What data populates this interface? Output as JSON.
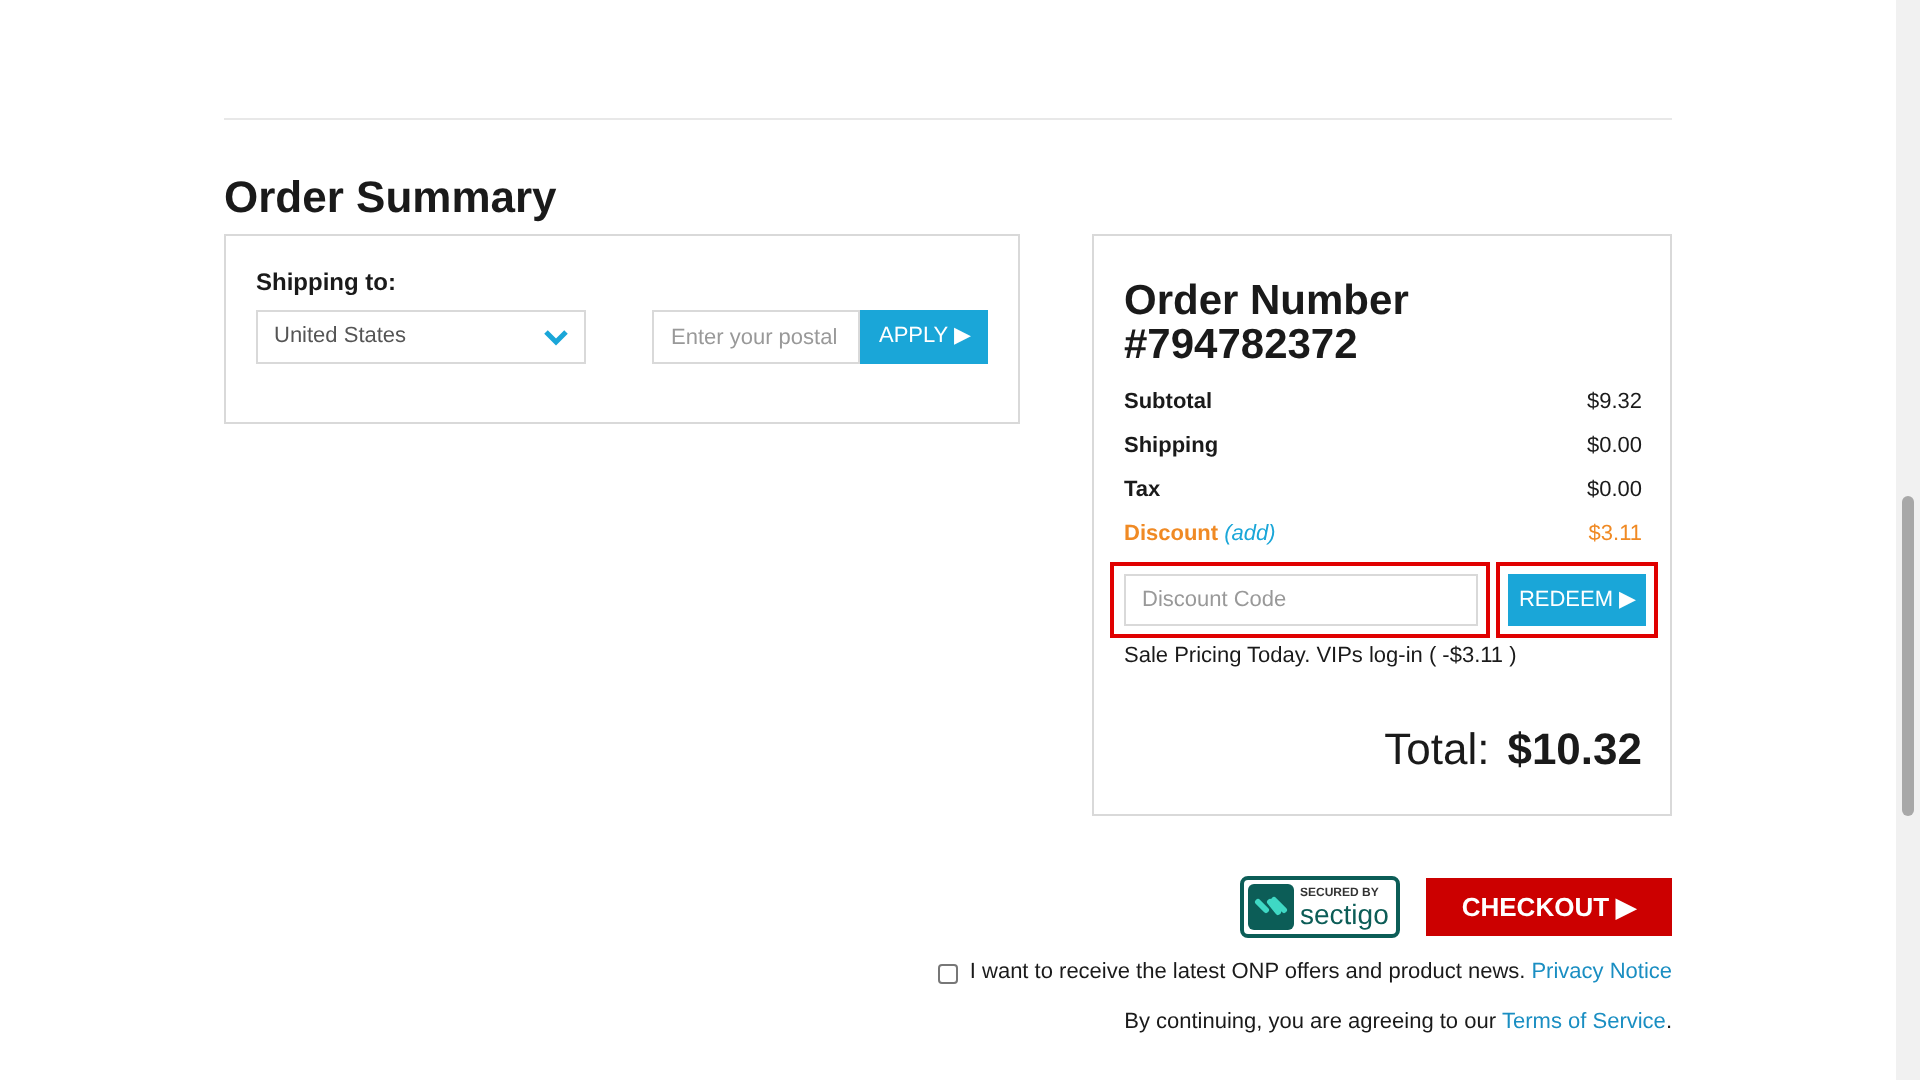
{
  "heading": "Order Summary",
  "shipping": {
    "label": "Shipping to:",
    "country": "United States",
    "postal_placeholder": "Enter your postal",
    "apply_button": "APPLY ▶"
  },
  "order": {
    "title_line1": "Order Number",
    "title_line2": "#794782372",
    "rows": [
      {
        "label": "Subtotal",
        "value": "$9.32",
        "kind": "plain"
      },
      {
        "label": "Shipping",
        "value": "$0.00",
        "kind": "plain"
      },
      {
        "label": "Tax",
        "value": "$0.00",
        "kind": "plain"
      },
      {
        "label": "Discount",
        "link": "(add)",
        "value": "$3.11",
        "kind": "discount"
      }
    ],
    "discount_placeholder": "Discount Code",
    "redeem_button": "REDEEM ▶",
    "note": "Sale Pricing Today. VIPs log-in ( -$3.11 )",
    "total_label": "Total:",
    "total_value": "$10.32"
  },
  "badge": {
    "top": "SECURED BY",
    "brand": "sectigo"
  },
  "checkout_button": "CHECKOUT ▶",
  "newsletter": {
    "checked": false,
    "text": "I want to receive the latest ONP offers and product news.",
    "link": "Privacy Notice"
  },
  "terms": {
    "text": "By continuing, you are agreeing to our",
    "link": "Terms of Service",
    "end": "."
  }
}
